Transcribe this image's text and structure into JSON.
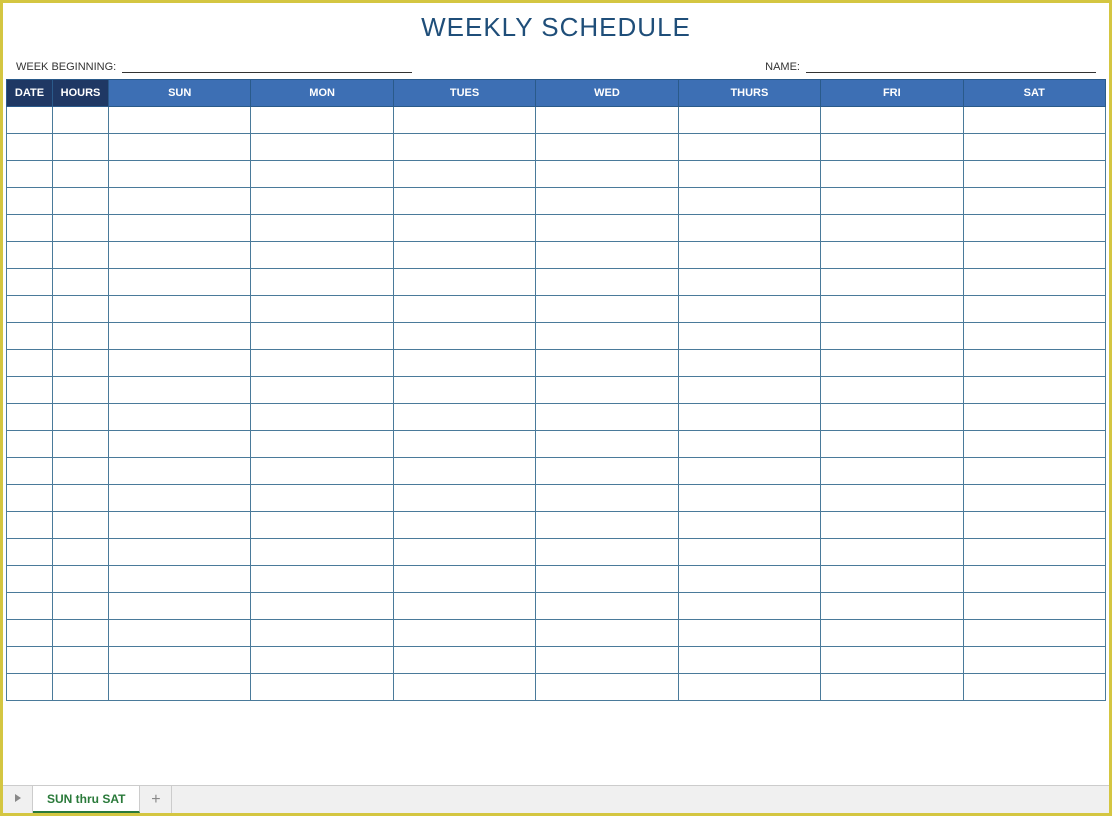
{
  "title": "WEEKLY SCHEDULE",
  "meta": {
    "week_beginning_label": "WEEK BEGINNING:",
    "week_beginning_value": "",
    "name_label": "NAME:",
    "name_value": ""
  },
  "table": {
    "headers": {
      "date": "DATE",
      "hours": "HOURS",
      "days": [
        "SUN",
        "MON",
        "TUES",
        "WED",
        "THURS",
        "FRI",
        "SAT"
      ]
    },
    "row_count": 22
  },
  "tabs": {
    "active_tab_label": "SUN thru SAT"
  }
}
